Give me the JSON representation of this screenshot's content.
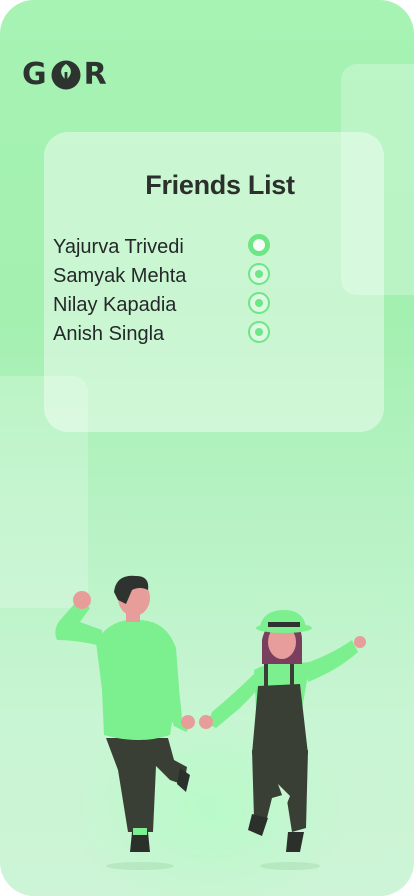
{
  "logo": {
    "letters": [
      "G",
      "R"
    ],
    "mid_icon": "tree-icon",
    "color": "#2d3430"
  },
  "card": {
    "title": "Friends List",
    "friends": [
      {
        "name": "Yajurva Trivedi",
        "selected": true
      },
      {
        "name": "Samyak Mehta",
        "selected": false
      },
      {
        "name": "Nilay Kapadia",
        "selected": false
      },
      {
        "name": "Anish Singla",
        "selected": false
      }
    ]
  },
  "colors": {
    "accent": "#6ee685",
    "background": "#a6f3b4",
    "text": "#25282a",
    "shirt": "#7cf08f",
    "pants": "#3a3f36",
    "skin": "#e79e9a",
    "hair": "#2e3330"
  },
  "illustration": "couple-walking-holding-hands"
}
